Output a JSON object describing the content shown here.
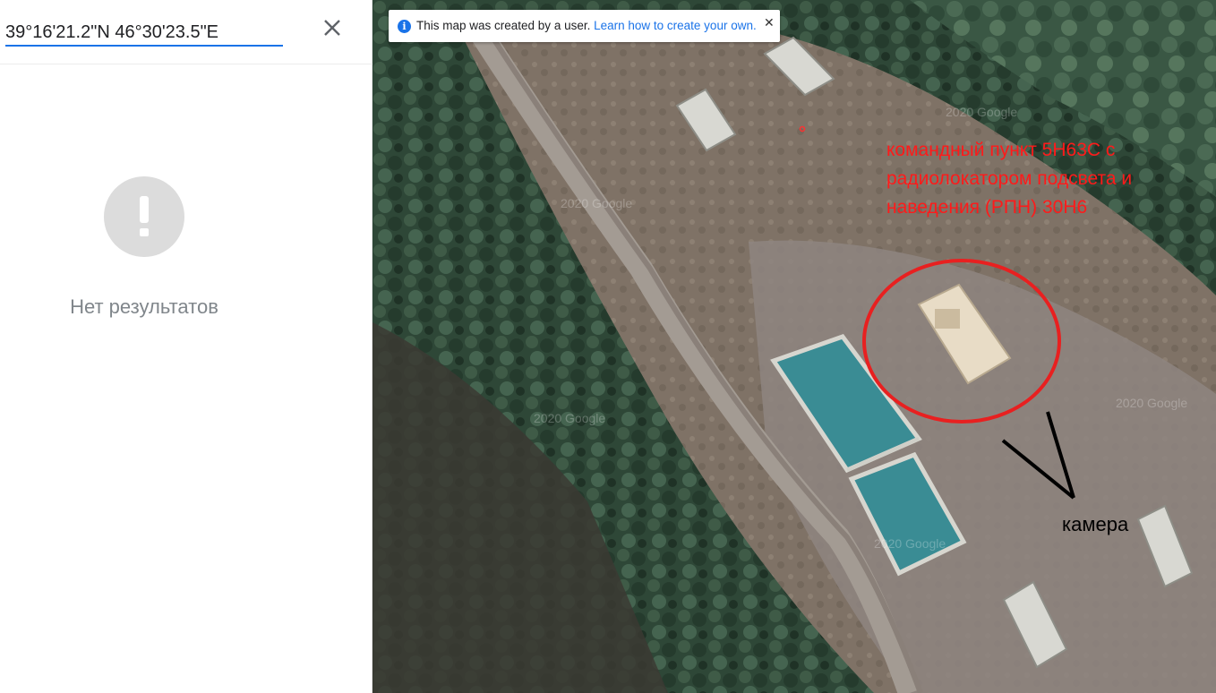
{
  "search": {
    "value": "39°16'21.2\"N 46°30'23.5\"E",
    "clear_icon": "close-icon"
  },
  "results": {
    "icon": "exclamation-icon",
    "empty_text": "Нет результатов"
  },
  "notice": {
    "text": "This map was created by a user.",
    "link": "Learn how to create your own.",
    "info_icon": "info-icon",
    "close_icon": "close-icon"
  },
  "annotations": {
    "red_label": "командный пункт 5Н63С с радиолокатором подсвета и наведения (РПН) 30Н6",
    "black_label": "камера",
    "red_color": "#ff1a1a"
  },
  "watermarks": [
    "2020 Google",
    "2020 Google",
    "2020 Google",
    "2020 Google",
    "2020 Google"
  ],
  "colors": {
    "accent": "#1a73e8",
    "forest": "#2f4a3a",
    "ground": "#8a7868",
    "roof": "#3a8c94"
  }
}
